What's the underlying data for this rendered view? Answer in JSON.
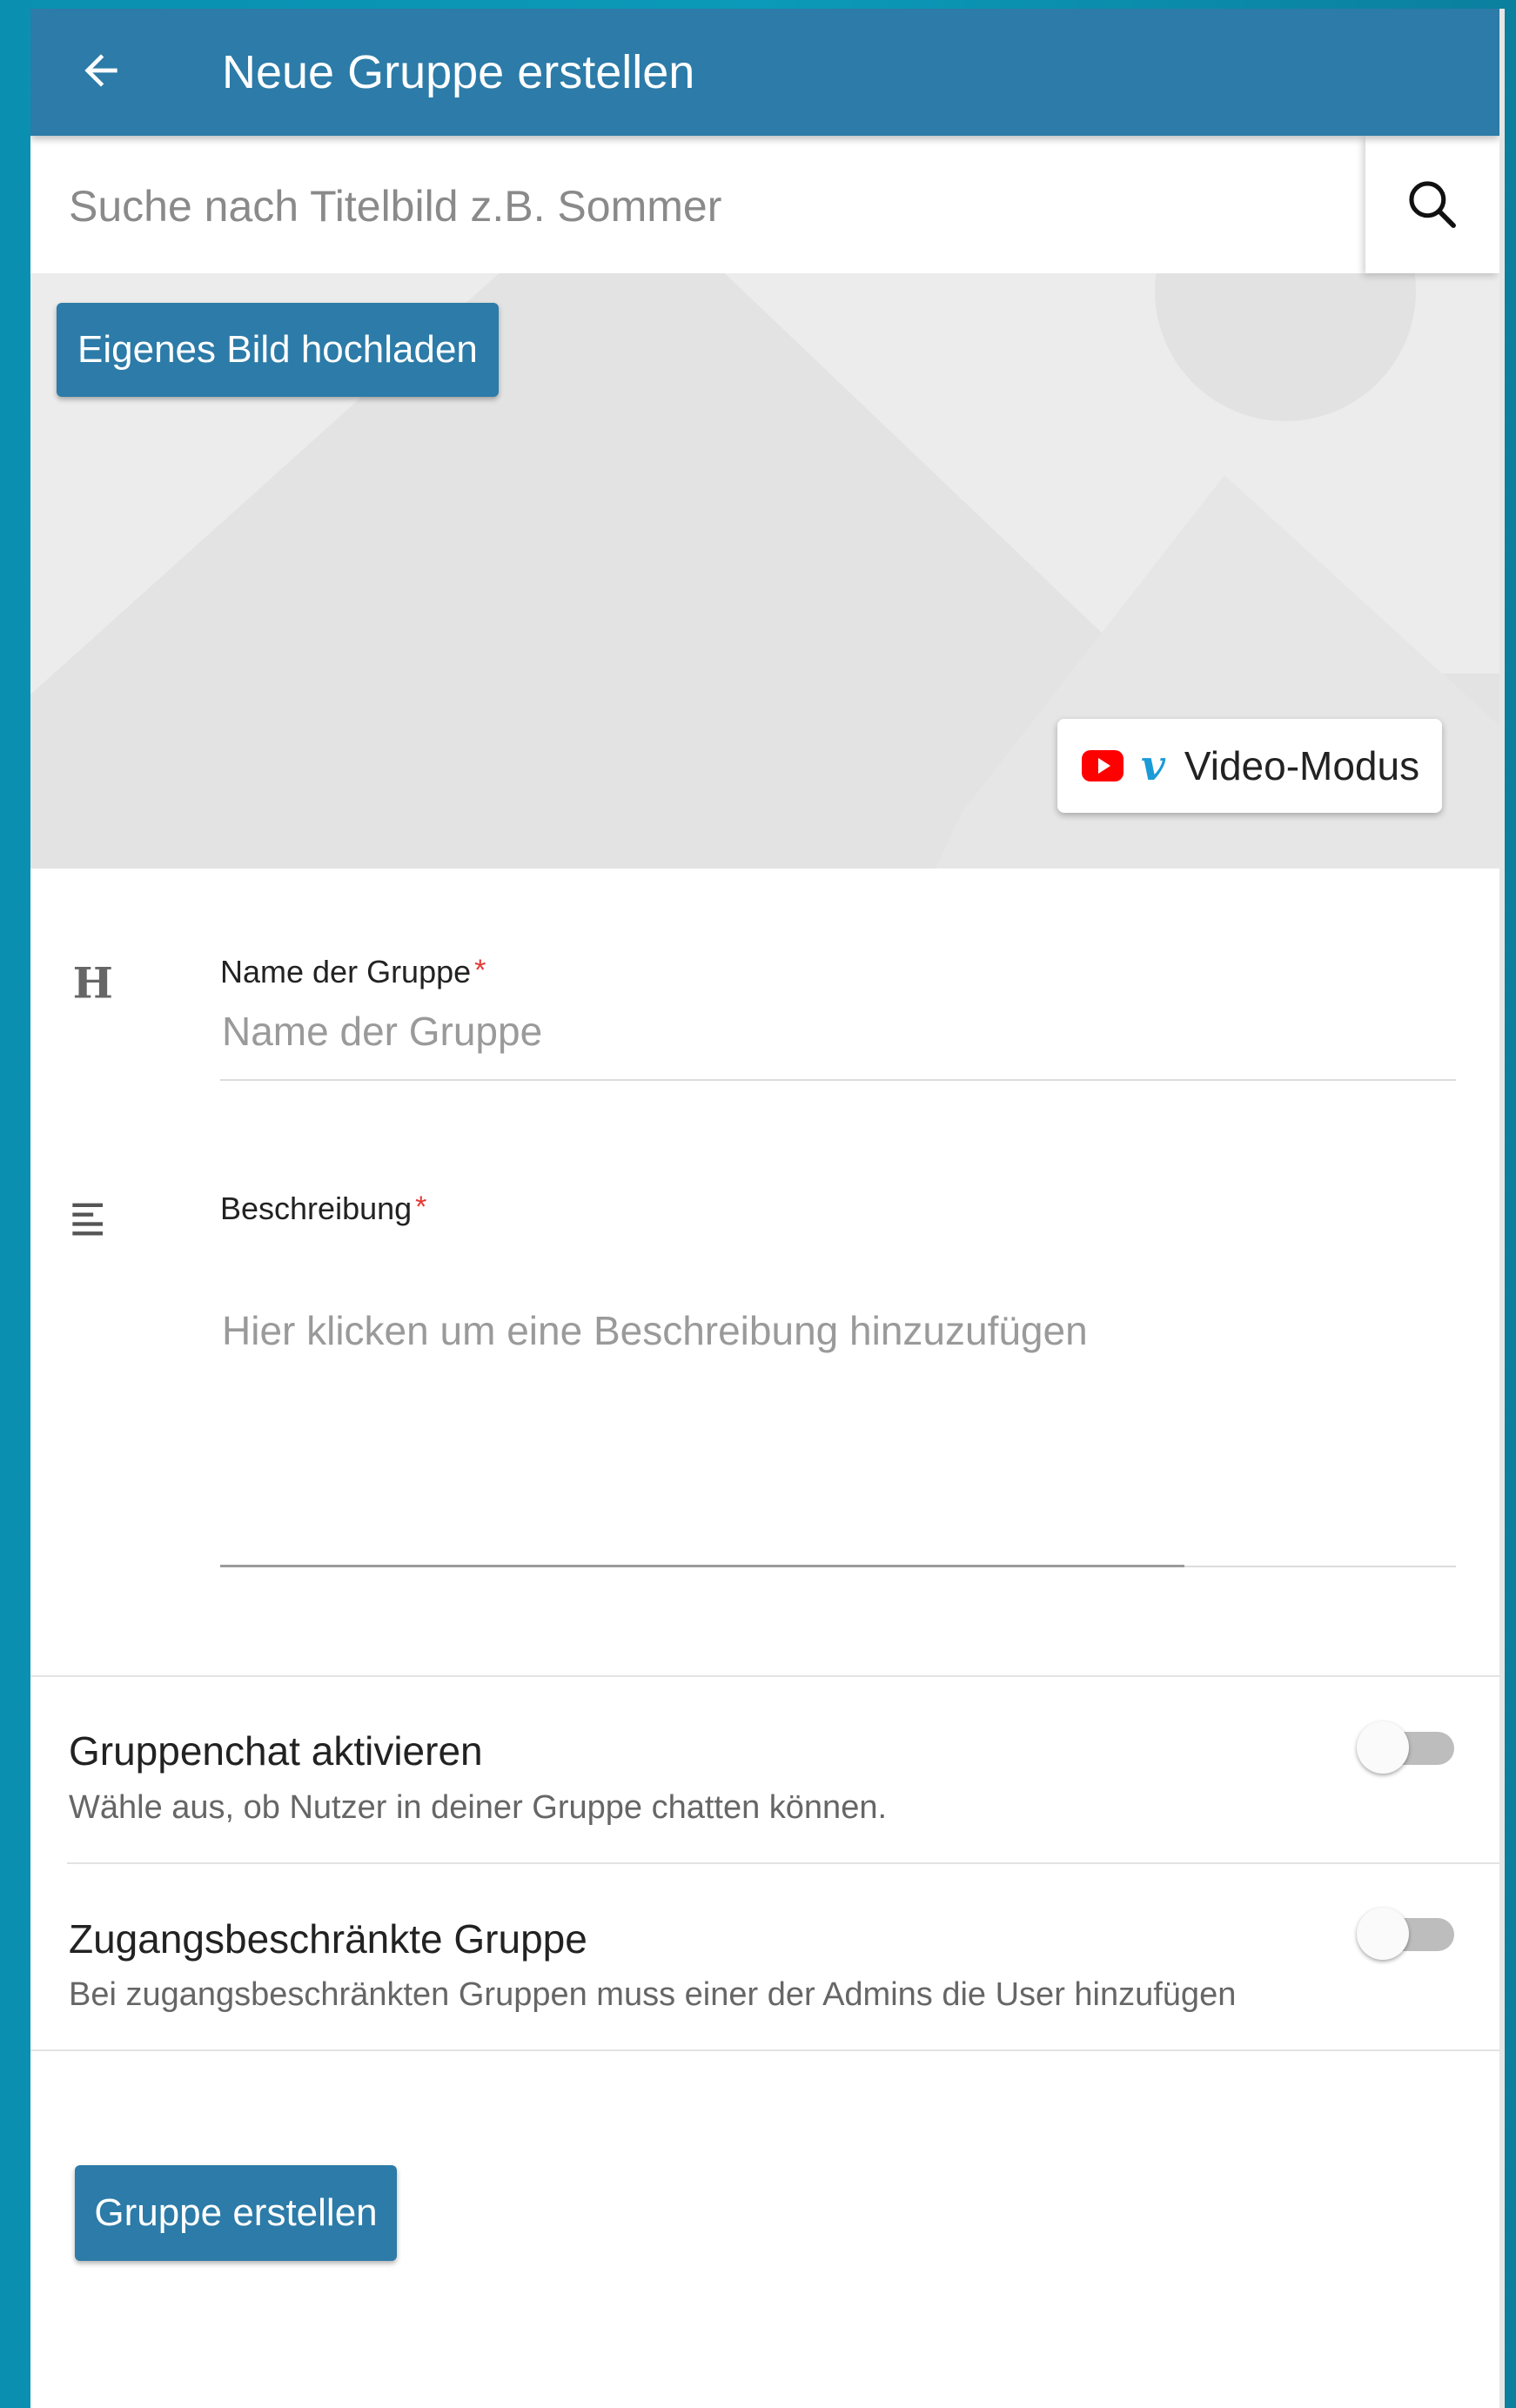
{
  "header": {
    "title": "Neue Gruppe erstellen",
    "back_icon": "arrow-left-icon"
  },
  "search": {
    "placeholder": "Suche nach Titelbild z.B. Sommer",
    "value": "",
    "icon": "search-icon"
  },
  "cover": {
    "upload_label": "Eigenes Bild hochladen",
    "video_mode_label": "Video-Modus",
    "video_icons": [
      "youtube-icon",
      "vimeo-icon"
    ],
    "vimeo_glyph": "v"
  },
  "form": {
    "name": {
      "label": "Name der Gruppe",
      "required_mark": "*",
      "placeholder": "Name der Gruppe",
      "value": "",
      "icon": "heading-icon"
    },
    "description": {
      "label": "Beschreibung",
      "required_mark": "*",
      "placeholder": "Hier klicken um eine Beschreibung hinzuzufügen",
      "value": "",
      "icon": "text-align-icon"
    }
  },
  "options": [
    {
      "title": "Gruppenchat aktivieren",
      "subtitle": "Wähle aus, ob Nutzer in deiner Gruppe chatten können.",
      "enabled": false
    },
    {
      "title": "Zugangsbeschränkte Gruppe",
      "subtitle": "Bei zugangsbeschränkten Gruppen muss einer der Admins die User hinzufügen",
      "enabled": false
    }
  ],
  "submit_label": "Gruppe erstellen",
  "colors": {
    "primary": "#2c7ba8",
    "background": "#0b96b5",
    "required": "#e53935",
    "youtube": "#ff0000",
    "vimeo": "#1a9bd7"
  }
}
